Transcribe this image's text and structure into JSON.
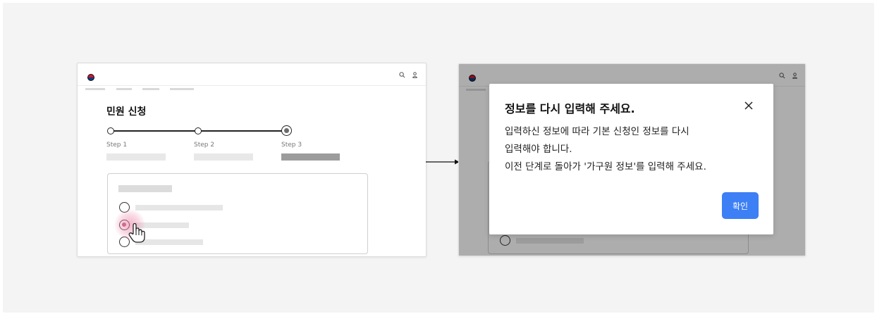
{
  "left_screen": {
    "page_title": "민원 신청",
    "header_icons": [
      "search-icon",
      "user-icon"
    ],
    "steps": [
      {
        "label": "Step 1",
        "state": "done"
      },
      {
        "label": "Step 2",
        "state": "done"
      },
      {
        "label": "Step 3",
        "state": "current"
      }
    ],
    "form_card": {
      "options": [
        {
          "selected": false
        },
        {
          "selected": true
        },
        {
          "selected": false
        }
      ]
    },
    "pointer": "hand-pointer-icon"
  },
  "arrow": "right-arrow-icon",
  "right_screen": {
    "modal": {
      "title": "정보를 다시 입력해 주세요.",
      "body_lines": [
        "입력하신 정보에 따라 기본 신청인 정보를 다시",
        "입력해야 합니다.",
        "이전 단계로 돌아가 '가구원 정보'를 입력해 주세요."
      ],
      "confirm_label": "확인",
      "close_icon": "close-icon"
    }
  },
  "colors": {
    "primary_button": "#3d7ff5",
    "selected_radio": "#c1507c",
    "tap_highlight": "#ec78a0",
    "overlay": "rgba(0,0,0,0.32)"
  }
}
